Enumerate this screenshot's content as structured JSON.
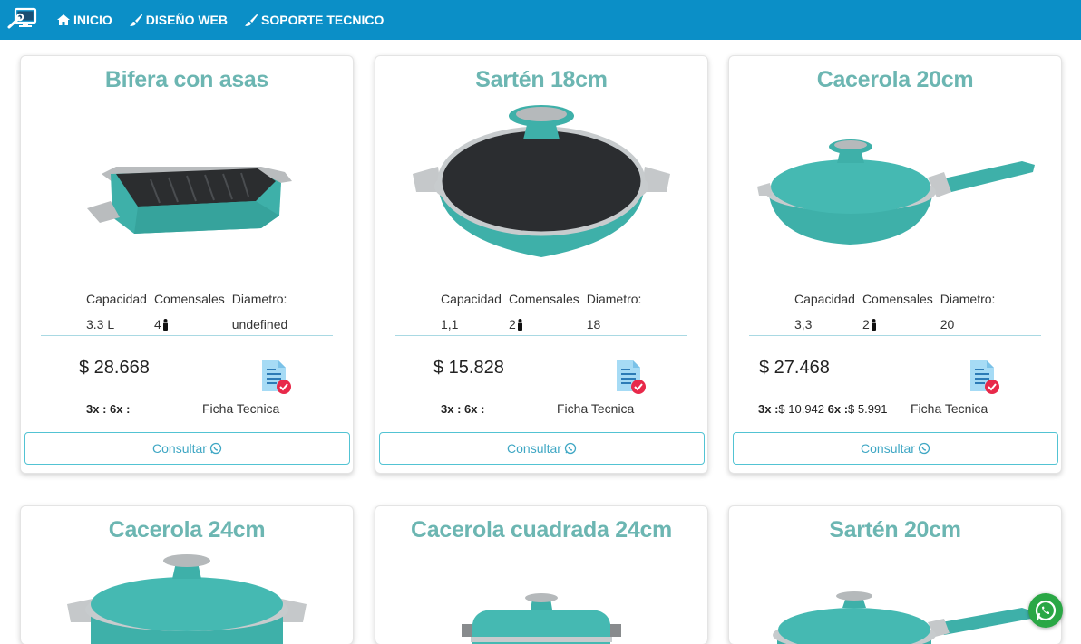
{
  "nav": {
    "links": [
      {
        "label": "INICIO",
        "icon": "home-icon"
      },
      {
        "label": "DISEÑO WEB",
        "icon": "brush-icon"
      },
      {
        "label": "SOPORTE TECNICO",
        "icon": "brush-icon"
      }
    ],
    "brand_icon": "wrench-monitor-icon",
    "color": "#0b8fc7"
  },
  "labels": {
    "capacidad": "Capacidad",
    "comensales": "Comensales",
    "diametro": "Diametro:",
    "ficha": "Ficha Tecnica",
    "consultar": "Consultar",
    "dues_3x": "3x :",
    "dues_6x": "6x :"
  },
  "products": [
    {
      "title": "Bifera con asas",
      "capacidad": "3.3 L",
      "comensales": "4",
      "diametro": "undefined",
      "price": "$ 28.668",
      "dues_3x_val": "",
      "dues_6x_val": ""
    },
    {
      "title": "Sartén 18cm",
      "capacidad": "1,1",
      "comensales": "2",
      "diametro": "18",
      "price": "$ 15.828",
      "dues_3x_val": "",
      "dues_6x_val": ""
    },
    {
      "title": "Cacerola 20cm",
      "capacidad": "3,3",
      "comensales": "2",
      "diametro": "20",
      "price": "$ 27.468",
      "dues_3x_val": "$ 10.942",
      "dues_6x_val": "$ 5.991"
    },
    {
      "title": "Cacerola 24cm"
    },
    {
      "title": "Cacerola cuadrada 24cm"
    },
    {
      "title": "Sartén 20cm"
    }
  ],
  "colors": {
    "accent": "#6cb6b2",
    "pot": "#3fb3ad",
    "button": "#52c3d3",
    "whatsapp": "#2aa745"
  }
}
